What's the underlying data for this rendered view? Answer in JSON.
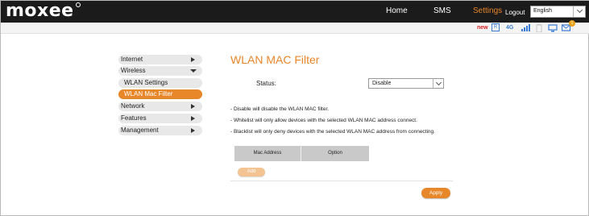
{
  "header": {
    "logo": "moxee",
    "nav": [
      "Home",
      "SMS",
      "Settings"
    ],
    "logout": "Logout",
    "language": "English"
  },
  "status_icons": {
    "new": "new",
    "sim": "R",
    "network": "4G",
    "sms_count": "1"
  },
  "sidebar": {
    "items": [
      {
        "label": "Internet"
      },
      {
        "label": "Wireless"
      },
      {
        "label": "WLAN Settings"
      },
      {
        "label": "WLAN Mac Filter"
      },
      {
        "label": "Network"
      },
      {
        "label": "Features"
      },
      {
        "label": "Management"
      }
    ]
  },
  "main": {
    "title": "WLAN MAC Filter",
    "status_label": "Status:",
    "status_value": "Disable",
    "notes": [
      "- Disable will disable the WLAN MAC filter.",
      "- Whitelist will only allow devices with the selected WLAN MAC address connect.",
      "- Blacklist will only deny devices with the selected WLAN MAC address from connecting."
    ],
    "table_headers": [
      "Mac Address",
      "Option"
    ],
    "add_label": "Add",
    "apply_label": "Apply"
  },
  "colors": {
    "accent": "#e8862a",
    "header_bg": "#1b1b1b",
    "table_header": "#c9c9c9"
  }
}
